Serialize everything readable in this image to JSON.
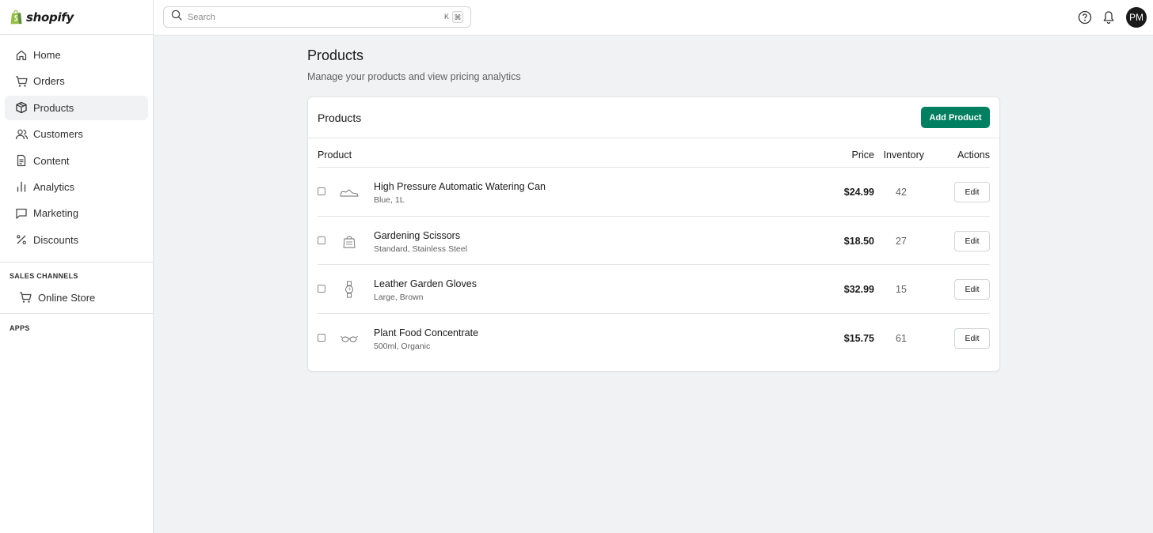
{
  "brand": {
    "name": "shopify",
    "logo_icon": "shopify-bag-icon",
    "accent": "#95bf47"
  },
  "sidebar": {
    "items": [
      {
        "label": "Home",
        "icon": "home-icon"
      },
      {
        "label": "Orders",
        "icon": "cart-icon"
      },
      {
        "label": "Products",
        "icon": "tag-box-icon",
        "active": true
      },
      {
        "label": "Customers",
        "icon": "people-icon"
      },
      {
        "label": "Content",
        "icon": "document-icon"
      },
      {
        "label": "Analytics",
        "icon": "bar-chart-icon"
      },
      {
        "label": "Marketing",
        "icon": "chat-icon"
      },
      {
        "label": "Discounts",
        "icon": "percent-icon"
      }
    ],
    "sales_channels": {
      "title": "SALES CHANNELS",
      "items": [
        {
          "label": "Online Store",
          "icon": "cart-icon"
        }
      ]
    },
    "apps": {
      "title": "APPS"
    }
  },
  "topbar": {
    "search": {
      "placeholder": "Search",
      "shortcut_key": "K",
      "shortcut_mod": "⌘"
    },
    "avatar_initials": "PM"
  },
  "main": {
    "title": "Products",
    "subtitle": "Manage your products and view pricing analytics",
    "card": {
      "title": "Products",
      "add_button": "Add Product",
      "columns": {
        "product": "Product",
        "price": "Price",
        "inventory": "Inventory",
        "actions": "Actions"
      },
      "rows": [
        {
          "name": "High Pressure Automatic Watering Can",
          "variant": "Blue, 1L",
          "price": "$24.99",
          "inventory": "42",
          "action": "Edit",
          "thumb": "shoe-thumbnail-icon"
        },
        {
          "name": "Gardening Scissors",
          "variant": "Standard, Stainless Steel",
          "price": "$18.50",
          "inventory": "27",
          "action": "Edit",
          "thumb": "bag-thumbnail-icon"
        },
        {
          "name": "Leather Garden Gloves",
          "variant": "Large, Brown",
          "price": "$32.99",
          "inventory": "15",
          "action": "Edit",
          "thumb": "watch-thumbnail-icon"
        },
        {
          "name": "Plant Food Concentrate",
          "variant": "500ml, Organic",
          "price": "$15.75",
          "inventory": "61",
          "action": "Edit",
          "thumb": "glasses-thumbnail-icon"
        }
      ]
    }
  },
  "colors": {
    "primary_button": "#008060",
    "active_nav": "#f1f2f4",
    "page_bg": "#f1f2f4"
  }
}
